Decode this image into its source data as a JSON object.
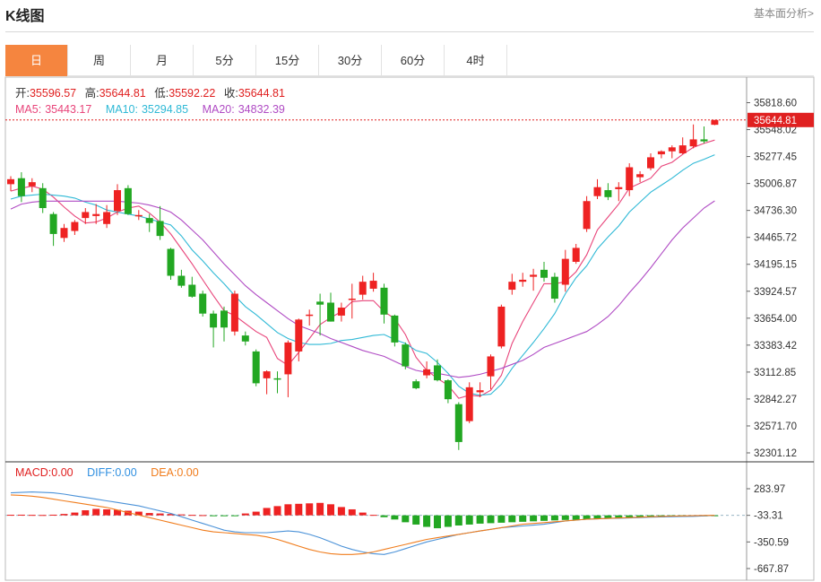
{
  "header": {
    "title": "K线图",
    "link": "基本面分析>"
  },
  "tabs": [
    "日",
    "周",
    "月",
    "5分",
    "15分",
    "30分",
    "60分",
    "4时"
  ],
  "active_tab": 0,
  "ohlc": {
    "open_label": "开:",
    "open": "35596.57",
    "high_label": "高:",
    "high": "35644.81",
    "low_label": "低:",
    "low": "35592.22",
    "close_label": "收:",
    "close": "35644.81"
  },
  "ma": [
    {
      "label": "MA5:",
      "value": "35443.17",
      "color": "#e8447a"
    },
    {
      "label": "MA10:",
      "value": "35294.85",
      "color": "#2fb9d6"
    },
    {
      "label": "MA20:",
      "value": "34832.39",
      "color": "#b04bc4"
    }
  ],
  "macd_legend": [
    {
      "label": "MACD:",
      "value": "0.00",
      "color": "#e02020"
    },
    {
      "label": "DIFF:",
      "value": "0.00",
      "color": "#2f8fe0"
    },
    {
      "label": "DEA:",
      "value": "0.00",
      "color": "#f07c1c"
    }
  ],
  "colors": {
    "up": "#ee2222",
    "down": "#22a722",
    "diff": "#4b92d8",
    "dea": "#f07c1c",
    "last_price": "#e02020"
  },
  "chart_data": [
    {
      "type": "candlestick",
      "title": "K线图",
      "y_ticks": [
        "35818.60",
        "35548.02",
        "35277.45",
        "35006.87",
        "34736.30",
        "34465.72",
        "34195.15",
        "33924.57",
        "33654.00",
        "33383.42",
        "33112.85",
        "32842.27",
        "32571.70",
        "32301.12"
      ],
      "ylim": [
        32301.12,
        35818.6
      ],
      "last_price_label": "35644.81",
      "last_price": 35644.81,
      "candles": [
        {
          "o": 35000,
          "h": 35080,
          "l": 34930,
          "c": 35050
        },
        {
          "o": 35060,
          "h": 35120,
          "l": 34820,
          "c": 34880
        },
        {
          "o": 34980,
          "h": 35060,
          "l": 34920,
          "c": 35020
        },
        {
          "o": 34960,
          "h": 35010,
          "l": 34710,
          "c": 34760
        },
        {
          "o": 34700,
          "h": 34720,
          "l": 34380,
          "c": 34500
        },
        {
          "o": 34460,
          "h": 34600,
          "l": 34420,
          "c": 34560
        },
        {
          "o": 34530,
          "h": 34640,
          "l": 34490,
          "c": 34620
        },
        {
          "o": 34660,
          "h": 34760,
          "l": 34600,
          "c": 34720
        },
        {
          "o": 34680,
          "h": 34800,
          "l": 34600,
          "c": 34700
        },
        {
          "o": 34600,
          "h": 34790,
          "l": 34560,
          "c": 34720
        },
        {
          "o": 34730,
          "h": 35000,
          "l": 34690,
          "c": 34940
        },
        {
          "o": 34960,
          "h": 34990,
          "l": 34690,
          "c": 34700
        },
        {
          "o": 34690,
          "h": 34740,
          "l": 34640,
          "c": 34690
        },
        {
          "o": 34660,
          "h": 34700,
          "l": 34520,
          "c": 34610
        },
        {
          "o": 34630,
          "h": 34780,
          "l": 34440,
          "c": 34480
        },
        {
          "o": 34350,
          "h": 34360,
          "l": 34040,
          "c": 34080
        },
        {
          "o": 34080,
          "h": 34140,
          "l": 33960,
          "c": 33980
        },
        {
          "o": 33990,
          "h": 34070,
          "l": 33860,
          "c": 33870
        },
        {
          "o": 33900,
          "h": 33930,
          "l": 33670,
          "c": 33700
        },
        {
          "o": 33700,
          "h": 33730,
          "l": 33360,
          "c": 33560
        },
        {
          "o": 33730,
          "h": 33770,
          "l": 33420,
          "c": 33560
        },
        {
          "o": 33520,
          "h": 33930,
          "l": 33480,
          "c": 33900
        },
        {
          "o": 33480,
          "h": 33520,
          "l": 33380,
          "c": 33420
        },
        {
          "o": 33320,
          "h": 33340,
          "l": 32970,
          "c": 33000
        },
        {
          "o": 33050,
          "h": 33130,
          "l": 32890,
          "c": 33120
        },
        {
          "o": 33050,
          "h": 33120,
          "l": 32900,
          "c": 33040
        },
        {
          "o": 33090,
          "h": 33430,
          "l": 32860,
          "c": 33410
        },
        {
          "o": 33320,
          "h": 33650,
          "l": 33220,
          "c": 33640
        },
        {
          "o": 33690,
          "h": 33740,
          "l": 33580,
          "c": 33690
        },
        {
          "o": 33820,
          "h": 33900,
          "l": 33480,
          "c": 33790
        },
        {
          "o": 33810,
          "h": 33910,
          "l": 33620,
          "c": 33620
        },
        {
          "o": 33680,
          "h": 33810,
          "l": 33620,
          "c": 33760
        },
        {
          "o": 33850,
          "h": 34000,
          "l": 33650,
          "c": 33850
        },
        {
          "o": 33890,
          "h": 34080,
          "l": 33840,
          "c": 34020
        },
        {
          "o": 33950,
          "h": 34110,
          "l": 33920,
          "c": 34030
        },
        {
          "o": 33960,
          "h": 34000,
          "l": 33600,
          "c": 33690
        },
        {
          "o": 33680,
          "h": 33690,
          "l": 33370,
          "c": 33410
        },
        {
          "o": 33390,
          "h": 33410,
          "l": 33140,
          "c": 33170
        },
        {
          "o": 33020,
          "h": 33040,
          "l": 32940,
          "c": 32950
        },
        {
          "o": 33080,
          "h": 33220,
          "l": 33050,
          "c": 33140
        },
        {
          "o": 33180,
          "h": 33240,
          "l": 33020,
          "c": 33030
        },
        {
          "o": 33030,
          "h": 33040,
          "l": 32800,
          "c": 32840
        },
        {
          "o": 32790,
          "h": 32810,
          "l": 32330,
          "c": 32410
        },
        {
          "o": 32620,
          "h": 33010,
          "l": 32600,
          "c": 32960
        },
        {
          "o": 32910,
          "h": 33010,
          "l": 32860,
          "c": 32930
        },
        {
          "o": 33070,
          "h": 33290,
          "l": 32940,
          "c": 33270
        },
        {
          "o": 33370,
          "h": 33790,
          "l": 33350,
          "c": 33770
        },
        {
          "o": 33940,
          "h": 34100,
          "l": 33890,
          "c": 34020
        },
        {
          "o": 34020,
          "h": 34110,
          "l": 33970,
          "c": 34040
        },
        {
          "o": 34070,
          "h": 34150,
          "l": 33930,
          "c": 34090
        },
        {
          "o": 34140,
          "h": 34220,
          "l": 34020,
          "c": 34060
        },
        {
          "o": 34070,
          "h": 34110,
          "l": 33810,
          "c": 33850
        },
        {
          "o": 33990,
          "h": 34340,
          "l": 33920,
          "c": 34250
        },
        {
          "o": 34220,
          "h": 34400,
          "l": 34200,
          "c": 34360
        },
        {
          "o": 34550,
          "h": 34880,
          "l": 34520,
          "c": 34830
        },
        {
          "o": 34880,
          "h": 35050,
          "l": 34850,
          "c": 34970
        },
        {
          "o": 34940,
          "h": 35010,
          "l": 34840,
          "c": 34870
        },
        {
          "o": 34950,
          "h": 35020,
          "l": 34830,
          "c": 34970
        },
        {
          "o": 34940,
          "h": 35210,
          "l": 34880,
          "c": 35170
        },
        {
          "o": 35070,
          "h": 35130,
          "l": 35020,
          "c": 35100
        },
        {
          "o": 35160,
          "h": 35310,
          "l": 35140,
          "c": 35270
        },
        {
          "o": 35300,
          "h": 35340,
          "l": 35260,
          "c": 35330
        },
        {
          "o": 35330,
          "h": 35390,
          "l": 35260,
          "c": 35370
        },
        {
          "o": 35310,
          "h": 35470,
          "l": 35300,
          "c": 35390
        },
        {
          "o": 35380,
          "h": 35600,
          "l": 35360,
          "c": 35450
        },
        {
          "o": 35450,
          "h": 35580,
          "l": 35410,
          "c": 35430
        },
        {
          "o": 35596.57,
          "h": 35644.81,
          "l": 35592.22,
          "c": 35644.81
        }
      ],
      "series": [
        {
          "name": "MA5",
          "values": [
            34930,
            34960,
            34980,
            34950,
            34870,
            34770,
            34680,
            34610,
            34620,
            34660,
            34720,
            34760,
            34780,
            34710,
            34620,
            34500,
            34350,
            34200,
            34040,
            33880,
            33730,
            33680,
            33600,
            33520,
            33460,
            33250,
            33180,
            33310,
            33450,
            33590,
            33660,
            33720,
            33820,
            33830,
            33830,
            33720,
            33650,
            33490,
            33260,
            33130,
            33050,
            32980,
            32850,
            32880,
            32870,
            32930,
            33080,
            33400,
            33620,
            33810,
            34000,
            34000,
            34020,
            34120,
            34290,
            34540,
            34670,
            34800,
            34960,
            35010,
            35060,
            35180,
            35220,
            35300,
            35370,
            35410,
            35443.17
          ]
        },
        {
          "name": "MA10",
          "values": [
            34850,
            34880,
            34890,
            34900,
            34890,
            34880,
            34860,
            34820,
            34790,
            34740,
            34720,
            34700,
            34680,
            34650,
            34620,
            34590,
            34480,
            34340,
            34230,
            34110,
            34000,
            33880,
            33770,
            33690,
            33600,
            33510,
            33450,
            33410,
            33390,
            33390,
            33400,
            33430,
            33440,
            33460,
            33480,
            33490,
            33440,
            33400,
            33330,
            33300,
            33210,
            33100,
            32970,
            32900,
            32880,
            32890,
            32990,
            33150,
            33280,
            33410,
            33550,
            33700,
            33900,
            34060,
            34180,
            34350,
            34470,
            34580,
            34720,
            34820,
            34920,
            34990,
            35060,
            35140,
            35210,
            35250,
            35294.85
          ]
        },
        {
          "name": "MA20",
          "values": [
            34750,
            34800,
            34820,
            34830,
            34830,
            34830,
            34830,
            34830,
            34830,
            34830,
            34830,
            34820,
            34810,
            34790,
            34760,
            34720,
            34640,
            34540,
            34440,
            34320,
            34200,
            34090,
            33980,
            33890,
            33810,
            33730,
            33650,
            33580,
            33540,
            33500,
            33450,
            33410,
            33370,
            33330,
            33300,
            33270,
            33220,
            33170,
            33130,
            33110,
            33100,
            33080,
            33060,
            33070,
            33090,
            33120,
            33150,
            33190,
            33230,
            33290,
            33360,
            33400,
            33440,
            33480,
            33520,
            33590,
            33670,
            33780,
            33910,
            34030,
            34160,
            34300,
            34440,
            34560,
            34660,
            34760,
            34832.39
          ]
        }
      ]
    },
    {
      "type": "bar",
      "title": "MACD",
      "y_ticks": [
        "283.97",
        "-33.31",
        "-350.59",
        "-667.87"
      ],
      "ylim": [
        -700,
        380
      ],
      "macd": [
        12,
        14,
        10,
        8,
        14,
        30,
        60,
        110,
        140,
        130,
        120,
        100,
        80,
        50,
        40,
        30,
        20,
        10,
        5,
        -5,
        -10,
        -8,
        40,
        80,
        160,
        200,
        240,
        250,
        260,
        270,
        240,
        180,
        130,
        60,
        10,
        -40,
        -90,
        -150,
        -200,
        -250,
        -280,
        -250,
        -220,
        -200,
        -180,
        -170,
        -160,
        -150,
        -140,
        -130,
        -120,
        -110,
        -100,
        -95,
        -90,
        -80,
        -70,
        -60,
        -55,
        -50,
        -45,
        -40,
        -35,
        -30,
        -25,
        -20,
        -15
      ],
      "series": [
        {
          "name": "DIFF",
          "values": [
            235,
            240,
            245,
            240,
            235,
            220,
            200,
            180,
            160,
            140,
            120,
            100,
            80,
            50,
            20,
            -10,
            -50,
            -90,
            -130,
            -170,
            -210,
            -230,
            -240,
            -240,
            -240,
            -230,
            -220,
            -230,
            -260,
            -300,
            -350,
            -400,
            -440,
            -470,
            -490,
            -500,
            -470,
            -430,
            -390,
            -350,
            -320,
            -290,
            -260,
            -240,
            -220,
            -200,
            -180,
            -170,
            -160,
            -150,
            -140,
            -120,
            -100,
            -90,
            -80,
            -75,
            -70,
            -68,
            -65,
            -60,
            -55,
            -52,
            -50,
            -47,
            -45,
            -40,
            -33.31
          ]
        },
        {
          "name": "DEA",
          "values": [
            210,
            205,
            195,
            180,
            160,
            140,
            120,
            100,
            80,
            60,
            30,
            0,
            -30,
            -60,
            -90,
            -120,
            -150,
            -180,
            -210,
            -230,
            -240,
            -250,
            -260,
            -270,
            -290,
            -320,
            -360,
            -400,
            -440,
            -470,
            -490,
            -500,
            -500,
            -490,
            -470,
            -440,
            -410,
            -380,
            -350,
            -320,
            -300,
            -280,
            -260,
            -240,
            -220,
            -200,
            -180,
            -160,
            -140,
            -130,
            -120,
            -110,
            -100,
            -90,
            -80,
            -75,
            -70,
            -65,
            -60,
            -55,
            -50,
            -45,
            -42,
            -40,
            -38,
            -35,
            -33.31
          ]
        }
      ]
    }
  ]
}
